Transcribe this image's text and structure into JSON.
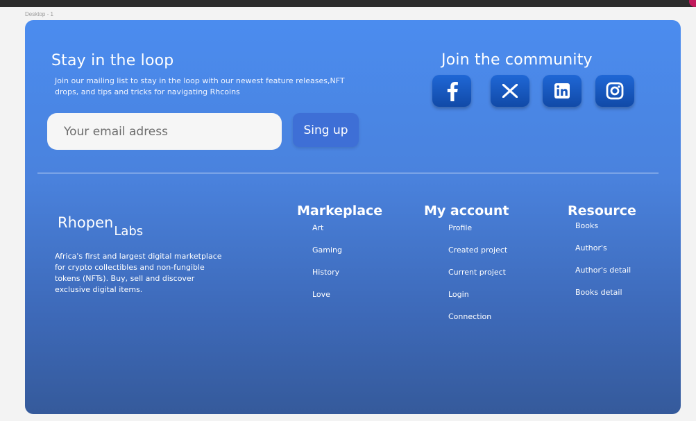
{
  "canvas": {
    "frame_label": "Desktop - 1"
  },
  "newsletter": {
    "title": "Stay in the loop",
    "description": "Join our mailing list to stay in the loop with our newest feature releases,NFT drops, and tips and tricks for navigating Rhcoins",
    "email_placeholder": "Your email adress",
    "email_value": "",
    "signup_label": "Sing up"
  },
  "community": {
    "title": "Join the community",
    "socials": [
      {
        "name": "facebook",
        "icon": "facebook-icon"
      },
      {
        "name": "x",
        "icon": "x-icon"
      },
      {
        "name": "linkedin",
        "icon": "linkedin-icon"
      },
      {
        "name": "instagram",
        "icon": "instagram-icon"
      }
    ]
  },
  "brand": {
    "name": "Rhopen",
    "sub": "Labs",
    "description": "Africa's first and largest digital marketplace for crypto collectibles and non-fungible tokens (NFTs). Buy, sell and  discover exclusive digital items."
  },
  "columns": {
    "marketplace": {
      "title": "Markeplace",
      "links": [
        "Art",
        "Gaming",
        "History",
        "Love"
      ]
    },
    "account": {
      "title": "My account",
      "links": [
        "Profile",
        "Created project",
        "Current project",
        "Login",
        "Connection"
      ]
    },
    "resource": {
      "title": "Resource",
      "links": [
        "Books",
        "Author's",
        "Author's detail",
        "Books detail"
      ]
    }
  },
  "colors": {
    "gradient_top": "#4b8cef",
    "gradient_bottom": "#355a9b",
    "button": "#3e6fd6",
    "social_button": "#1656bd",
    "canvas_background": "#f3f3f3"
  }
}
